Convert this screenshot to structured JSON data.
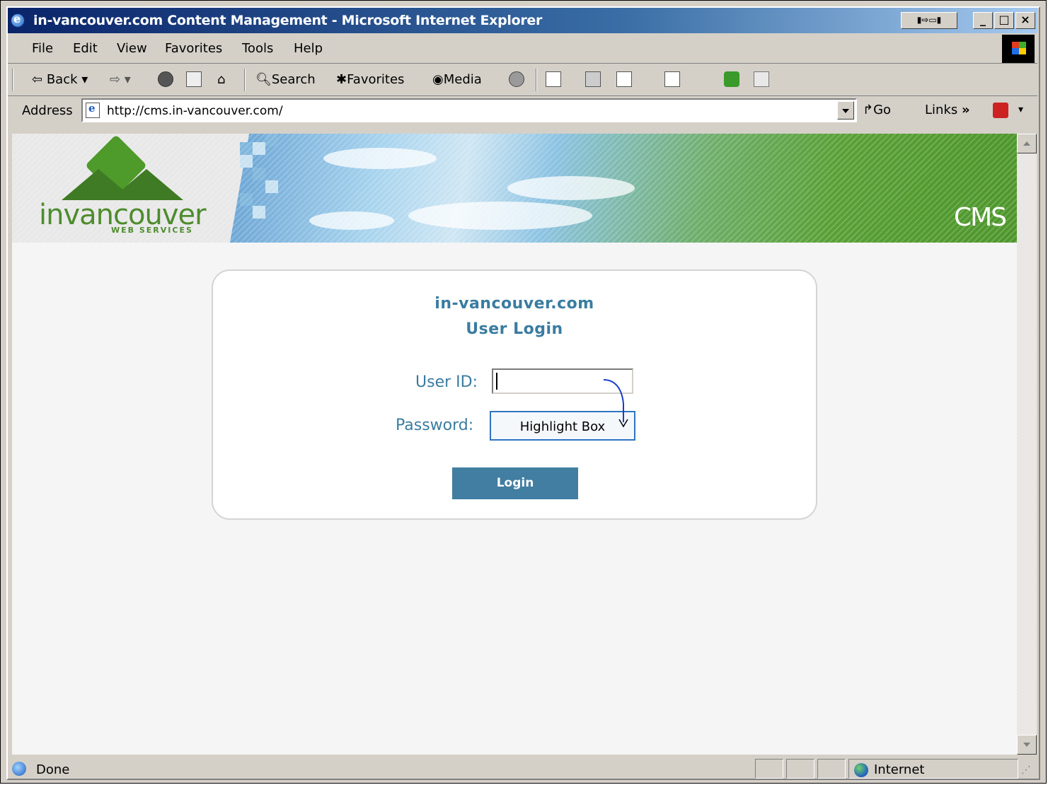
{
  "window": {
    "title": "in-vancouver.com Content Management - Microsoft Internet Explorer",
    "controls": [
      "_",
      "□",
      "×"
    ]
  },
  "menu": [
    "File",
    "Edit",
    "View",
    "Favorites",
    "Tools",
    "Help"
  ],
  "toolbar": {
    "back_label": "Back",
    "search_label": "Search",
    "favorites_label": "Favorites",
    "media_label": "Media"
  },
  "address": {
    "label": "Address",
    "url": "http://cms.in-vancouver.com/",
    "go_label": "Go",
    "links_label": "Links"
  },
  "banner": {
    "logo_text": "invancouver",
    "logo_sub": "WEB SERVICES",
    "cms_label": "CMS"
  },
  "login": {
    "site": "in-vancouver.com",
    "heading": "User Login",
    "user_id_label": "User ID:",
    "user_id_value": "",
    "password_label": "Password:",
    "password_annotation": "Highlight Box",
    "button_label": "Login"
  },
  "status": {
    "text": "Done",
    "zone": "Internet"
  },
  "colors": {
    "accent": "#417ea2",
    "label_text": "#3a7ca0",
    "highlight_border": "#2e74c2"
  }
}
